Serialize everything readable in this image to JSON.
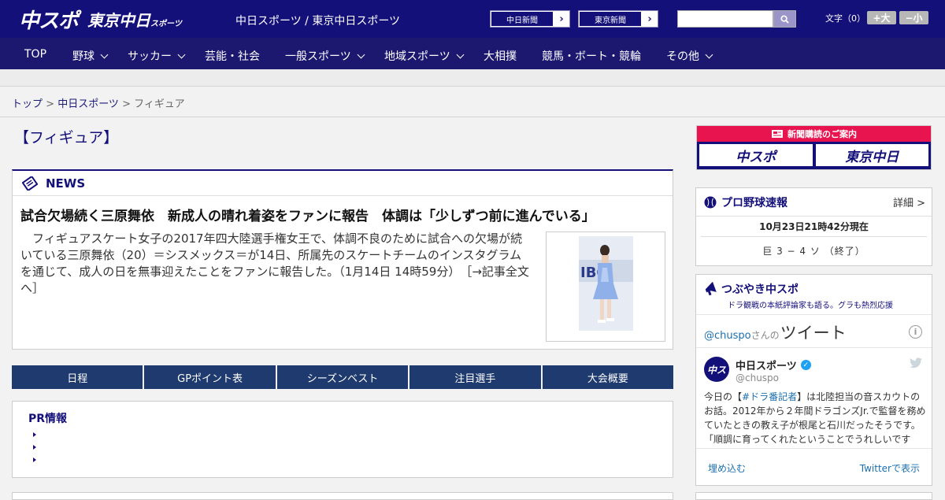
{
  "header": {
    "logo_main": "中スポ",
    "logo_sub": "東京中日",
    "logo_sub_small": "スポーツ",
    "site_name": "中日スポーツ / 東京中日スポーツ",
    "ext_links": [
      {
        "label": "中日新聞"
      },
      {
        "label": "東京新聞"
      }
    ],
    "search": {
      "value": "",
      "placeholder": ""
    },
    "fontsize_label": "文字（0）",
    "fontsize_bigger": "+大",
    "fontsize_smaller": "−小"
  },
  "nav": [
    {
      "label": "TOP",
      "dropdown": false
    },
    {
      "label": "野球",
      "dropdown": true
    },
    {
      "label": "サッカー",
      "dropdown": true
    },
    {
      "label": "芸能・社会",
      "dropdown": false
    },
    {
      "label": "一般スポーツ",
      "dropdown": true
    },
    {
      "label": "地域スポーツ",
      "dropdown": true
    },
    {
      "label": "大相撲",
      "dropdown": false
    },
    {
      "label": "競馬・ボート・競輪",
      "dropdown": false
    },
    {
      "label": "その他",
      "dropdown": true
    }
  ],
  "breadcrumb": {
    "top": "トップ",
    "sep1": " > ",
    "section": "中日スポーツ",
    "sep2": " > ",
    "current": "フィギュア"
  },
  "page_title": "【フィギュア】",
  "news": {
    "section_label": "NEWS",
    "headline": "試合欠場続く三原舞依　新成人の晴れ着姿をファンに報告　体調は「少しずつ前に進んでいる」",
    "lead": "フィギュアスケート女子の2017年四大陸選手権女王で、体調不良のために試合への欠場が続いている三原舞依（20）＝シスメックス＝が14日、所属先のスケートチームのインスタグラムを通じて、成人の日を無事迎えたことをファンに報告した。（1月14日 14時59分）",
    "more_link": "［→記事全文へ］"
  },
  "tabs": [
    "日程",
    "GPポイント表",
    "シーズンベスト",
    "注目選手",
    "大会概要"
  ],
  "pr": {
    "title": "PR情報"
  },
  "subscription": {
    "header": "新聞購読のご案内",
    "logo1": "中スポ",
    "logo2": "東京中日"
  },
  "baseball": {
    "title": "プロ野球速報",
    "detail": "詳細 >",
    "time": "10月23日21時42分現在",
    "score": "巨 3 − 4 ソ （終了）"
  },
  "twitter_widget": {
    "title": "つぶやき中スポ",
    "subtitle": "ドラ観戦の本紙評論家も語る。グラも熱烈応援",
    "handle_prefix": "@chuspo",
    "handle_suffix": "さんの",
    "tweet_word": "ツイート",
    "account_name": "中日スポーツ",
    "account_handle": "@chuspo",
    "tweet_pre": "今日の【",
    "tweet_tag": "#ドラ番記者",
    "tweet_post": "】は北陸担当の音スカウトのお話。2012年から２年間ドラゴンズJr.で監督を務めていたときの教え子が根尾と石川だったそうです。「順調に育ってくれたということでうれしいです",
    "embed_label": "埋め込む",
    "view_label": "Twitterで表示"
  }
}
